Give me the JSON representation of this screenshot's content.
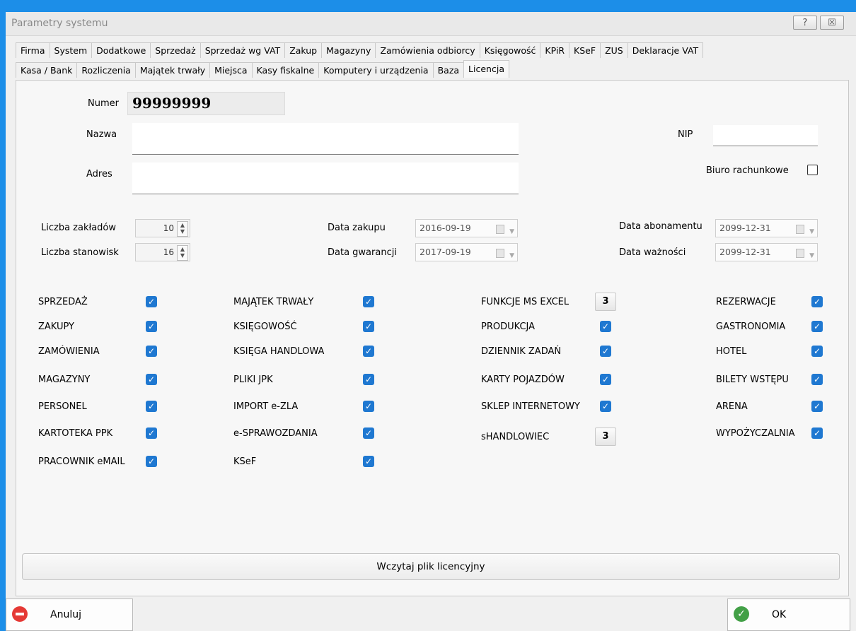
{
  "window": {
    "title": "Parametry systemu",
    "help_label": "?",
    "close_label": "☒"
  },
  "tabs_row1": [
    "Firma",
    "System",
    "Dodatkowe",
    "Sprzedaż",
    "Sprzedaż wg VAT",
    "Zakup",
    "Magazyny",
    "Zamówienia odbiorcy",
    "Księgowość",
    "KPiR",
    "KSeF",
    "ZUS",
    "Deklaracje VAT"
  ],
  "tabs_row2": [
    "Kasa / Bank",
    "Rozliczenia",
    "Majątek trwały",
    "Miejsca",
    "Kasy fiskalne",
    "Komputery i urządzenia",
    "Baza",
    "Licencja"
  ],
  "active_tab": "Licencja",
  "license": {
    "numer_label": "Numer",
    "numer_value": "99999999",
    "nazwa_label": "Nazwa",
    "nazwa_value": "",
    "adres_label": "Adres",
    "adres_value": "",
    "nip_label": "NIP",
    "nip_value": "",
    "biuro_label": "Biuro rachunkowe",
    "biuro_checked": false,
    "zaklady_label": "Liczba zakładów",
    "zaklady_value": "10",
    "stanowiska_label": "Liczba stanowisk",
    "stanowiska_value": "16",
    "data_zakupu_label": "Data zakupu",
    "data_zakupu_value": "2016-09-19",
    "data_gwarancji_label": "Data gwarancji",
    "data_gwarancji_value": "2017-09-19",
    "data_abonamentu_label": "Data abonamentu",
    "data_abonamentu_value": "2099-12-31",
    "data_waznosci_label": "Data ważności",
    "data_waznosci_value": "2099-12-31"
  },
  "modules": {
    "col1": [
      "SPRZEDAŻ",
      "ZAKUPY",
      "ZAMÓWIENIA",
      "MAGAZYNY",
      "PERSONEL",
      "KARTOTEKA PPK",
      "PRACOWNIK eMAIL"
    ],
    "col2": [
      "MAJĄTEK TRWAŁY",
      "KSIĘGOWOŚĆ",
      "KSIĘGA HANDLOWA",
      "PLIKI JPK",
      "IMPORT e-ZLA",
      "e-SPRAWOZDANIA",
      "KSeF"
    ],
    "col3": [
      "FUNKCJE MS EXCEL",
      "PRODUKCJA",
      "DZIENNIK ZADAŃ",
      "KARTY POJAZDÓW",
      "SKLEP INTERNETOWY",
      "sHANDLOWIEC"
    ],
    "col3_counts": {
      "excel": "3",
      "shandlowiec": "3"
    },
    "col4": [
      "REZERWACJE",
      "GASTRONOMIA",
      "HOTEL",
      "BILETY WSTĘPU",
      "ARENA",
      "WYPOŻYCZALNIA"
    ]
  },
  "buttons": {
    "load_license": "Wczytaj plik licencyjny",
    "cancel": "Anuluj",
    "ok": "OK"
  },
  "colors": {
    "accent": "#1c8ee8",
    "checkbox": "#1f78d1"
  }
}
